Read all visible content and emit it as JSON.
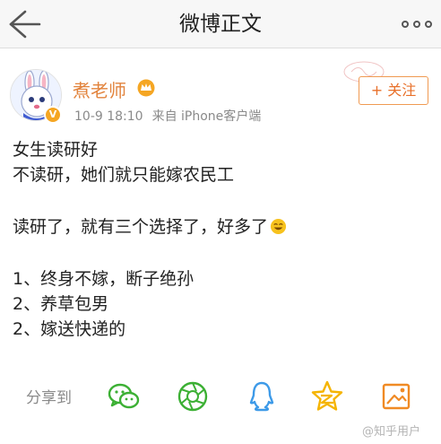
{
  "navbar": {
    "title": "微博正文"
  },
  "post": {
    "author": "煮老师",
    "time": "10-9 18:10",
    "source": "来自 iPhone客户端",
    "follow_label": "+ 关注",
    "lines": [
      "女生读研好",
      "不读研，她们就只能嫁农民工",
      "读研了，就有三个选择了，好多了",
      "1、终身不嫁，断子绝孙",
      "2、养草包男",
      "2、嫁送快递的"
    ]
  },
  "share": {
    "label": "分享到",
    "icons": [
      "wechat-icon",
      "moments-icon",
      "qq-icon",
      "qzone-icon",
      "weibo-photo-icon"
    ]
  },
  "watermark": "@知乎用户",
  "colors": {
    "author": "#e2833c",
    "follow": "#e8702a",
    "wechat": "#3cb034",
    "moments": "#3cb034",
    "qq": "#3d9ae8",
    "qzone": "#f5b400",
    "photo": "#f08a24"
  }
}
